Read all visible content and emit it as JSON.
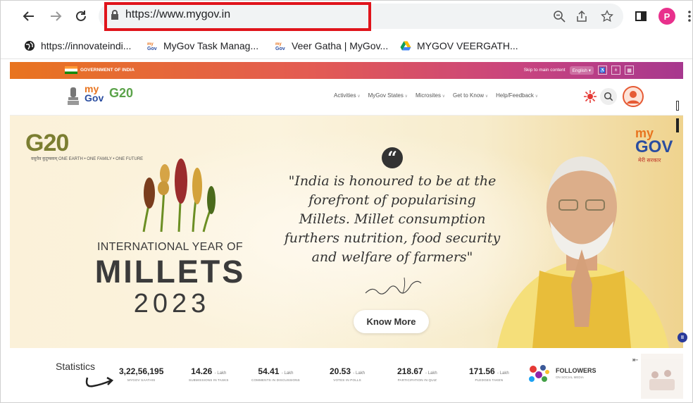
{
  "browser": {
    "url": "https://www.mygov.in",
    "profile_initial": "P",
    "icons": [
      "back-arrow-icon",
      "forward-arrow-icon",
      "reload-icon",
      "lock-icon",
      "zoom-icon",
      "share-icon",
      "star-icon",
      "sidepanel-icon",
      "menu-dots-icon"
    ]
  },
  "bookmarks": [
    {
      "label": "https://innovateindi...",
      "icon": "globe-icon"
    },
    {
      "label": "MyGov Task Manag...",
      "icon": "mygov-favicon"
    },
    {
      "label": "Veer Gatha | MyGov...",
      "icon": "mygov-favicon"
    },
    {
      "label": "MYGOV VEERGATH...",
      "icon": "drive-icon"
    }
  ],
  "gov_strip": {
    "left_label": "GOVERNMENT OF INDIA",
    "skip": "Skip to main content",
    "language": "English"
  },
  "header": {
    "logo_text_my": "my",
    "logo_text_gov": "Gov",
    "g20": "G20",
    "menu": [
      "Activities",
      "MyGov States",
      "Microsites",
      "Get to Know",
      "Help/Feedback"
    ]
  },
  "hero": {
    "g20": "G20",
    "g20_sub": "वसुधैव कुटुम्बकम् ONE EARTH • ONE FAMILY • ONE FUTURE",
    "mygov_my": "my",
    "mygov_gov": "GOV",
    "mygov_tag": "मेरी सरकार",
    "millets_line1": "INTERNATIONAL YEAR OF",
    "millets_line2": "MILLETS",
    "millets_year": "2023",
    "quote_mark": "“",
    "quote": "\"India is honoured to be at the forefront of popularising Millets. Millet consumption furthers nutrition, food security and welfare of farmers\"",
    "cta": "Know More"
  },
  "stats": {
    "title": "Statistics",
    "items": [
      {
        "value": "3,22,56,195",
        "unit": "",
        "label": "MYGOV SAATHIS"
      },
      {
        "value": "14.26",
        "unit": "Lakh",
        "label": "SUBMISSIONS IN TASKS"
      },
      {
        "value": "54.41",
        "unit": "Lakh",
        "label": "COMMENTS IN DISCUSSIONS"
      },
      {
        "value": "20.53",
        "unit": "Lakh",
        "label": "VOTES IN POLLS"
      },
      {
        "value": "218.67",
        "unit": "Lakh",
        "label": "PARTICIPATION IN QUIZ"
      },
      {
        "value": "171.56",
        "unit": "Lakh",
        "label": "PLEDGES TAKEN"
      }
    ],
    "followers": "FOLLOWERS",
    "followers_sub": "ON SOCIAL MEDIA"
  },
  "colors": {
    "red_box": "#e0141b",
    "strip_start": "#e8741f",
    "strip_end": "#a7388e",
    "profile": "#e8308c"
  }
}
